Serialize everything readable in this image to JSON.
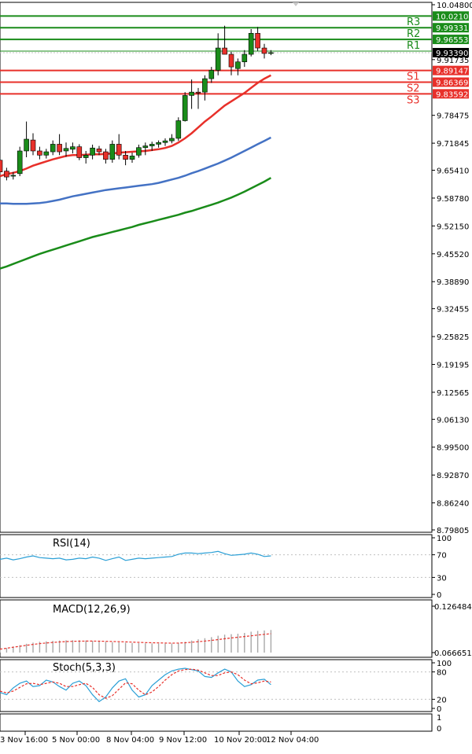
{
  "chart_data": [
    {
      "type": "candlestick",
      "title": "",
      "ylim": [
        8.79805,
        10.048
      ],
      "price_ticks": [
        "10.04800",
        "9.91735",
        "9.78475",
        "9.71845",
        "9.65410",
        "9.58780",
        "9.52150",
        "9.45520",
        "9.38890",
        "9.32455",
        "9.25825",
        "9.19195",
        "9.12565",
        "9.06130",
        "8.99500",
        "8.92870",
        "8.86240",
        "8.79805"
      ],
      "x_ticks": [
        "3 Nov 16:00",
        "5 Nov 00:00",
        "8 Nov 04:00",
        "9 Nov 12:00",
        "10 Nov 20:00",
        "12 Nov 04:00"
      ],
      "current_price": "9.93390",
      "levels": [
        {
          "label": "",
          "value": "10.02108",
          "kind": "resistance-top",
          "color": "#1a8c1a"
        },
        {
          "label": "R3",
          "value": "9.99331",
          "kind": "resistance",
          "color": "#1a8c1a"
        },
        {
          "label": "R2",
          "value": "9.96553",
          "kind": "resistance",
          "color": "#1a8c1a"
        },
        {
          "label": "R1",
          "value": "",
          "kind": "resistance",
          "color": "#1a8c1a"
        },
        {
          "label": "S1",
          "value": "9.89147",
          "kind": "support",
          "color": "#e8302a"
        },
        {
          "label": "S2",
          "value": "9.86369",
          "kind": "support",
          "color": "#e8302a"
        },
        {
          "label": "S3",
          "value": "9.83592",
          "kind": "support",
          "color": "#e8302a"
        }
      ],
      "candles": [
        [
          9.678,
          9.682,
          9.645,
          9.65
        ],
        [
          9.652,
          9.66,
          9.63,
          9.638
        ],
        [
          9.64,
          9.65,
          9.632,
          9.642
        ],
        [
          9.646,
          9.71,
          9.64,
          9.7
        ],
        [
          9.7,
          9.77,
          9.685,
          9.728
        ],
        [
          9.726,
          9.742,
          9.69,
          9.7
        ],
        [
          9.7,
          9.71,
          9.68,
          9.69
        ],
        [
          9.69,
          9.705,
          9.682,
          9.698
        ],
        [
          9.698,
          9.725,
          9.69,
          9.716
        ],
        [
          9.716,
          9.74,
          9.69,
          9.698
        ],
        [
          9.7,
          9.72,
          9.686,
          9.706
        ],
        [
          9.704,
          9.72,
          9.694,
          9.71
        ],
        [
          9.71,
          9.716,
          9.678,
          9.684
        ],
        [
          9.684,
          9.7,
          9.67,
          9.69
        ],
        [
          9.69,
          9.715,
          9.68,
          9.707
        ],
        [
          9.705,
          9.712,
          9.69,
          9.698
        ],
        [
          9.698,
          9.705,
          9.67,
          9.68
        ],
        [
          9.68,
          9.725,
          9.672,
          9.716
        ],
        [
          9.716,
          9.74,
          9.68,
          9.69
        ],
        [
          9.69,
          9.7,
          9.666,
          9.68
        ],
        [
          9.68,
          9.696,
          9.672,
          9.688
        ],
        [
          9.69,
          9.715,
          9.684,
          9.708
        ],
        [
          9.708,
          9.72,
          9.69,
          9.712
        ],
        [
          9.712,
          9.722,
          9.7,
          9.716
        ],
        [
          9.716,
          9.725,
          9.708,
          9.72
        ],
        [
          9.72,
          9.73,
          9.712,
          9.724
        ],
        [
          9.724,
          9.74,
          9.718,
          9.73
        ],
        [
          9.73,
          9.78,
          9.724,
          9.772
        ],
        [
          9.772,
          9.84,
          9.77,
          9.832
        ],
        [
          9.832,
          9.87,
          9.8,
          9.84
        ],
        [
          9.84,
          9.85,
          9.8,
          9.838
        ],
        [
          9.84,
          9.88,
          9.82,
          9.872
        ],
        [
          9.872,
          9.9,
          9.862,
          9.892
        ],
        [
          9.892,
          9.98,
          9.88,
          9.945
        ],
        [
          9.945,
          9.998,
          9.93,
          9.93
        ],
        [
          9.93,
          9.936,
          9.88,
          9.9
        ],
        [
          9.896,
          9.92,
          9.88,
          9.912
        ],
        [
          9.912,
          9.94,
          9.9,
          9.93
        ],
        [
          9.93,
          9.99,
          9.925,
          9.98
        ],
        [
          9.98,
          9.995,
          9.938,
          9.945
        ],
        [
          9.945,
          9.955,
          9.92,
          9.932
        ],
        [
          9.932,
          9.94,
          9.928,
          9.934
        ]
      ],
      "ma_red": [
        9.64,
        9.645,
        9.648,
        9.652,
        9.658,
        9.665,
        9.67,
        9.675,
        9.68,
        9.684,
        9.688,
        9.69,
        9.69,
        9.691,
        9.692,
        9.692,
        9.693,
        9.694,
        9.696,
        9.697,
        9.698,
        9.699,
        9.7,
        9.702,
        9.704,
        9.707,
        9.712,
        9.72,
        9.73,
        9.742,
        9.756,
        9.77,
        9.782,
        9.795,
        9.808,
        9.818,
        9.828,
        9.838,
        9.85,
        9.862,
        9.872,
        9.88
      ],
      "ma_blue": [
        9.575,
        9.575,
        9.574,
        9.574,
        9.574,
        9.575,
        9.576,
        9.578,
        9.581,
        9.584,
        9.588,
        9.592,
        9.595,
        9.598,
        9.601,
        9.604,
        9.607,
        9.609,
        9.611,
        9.613,
        9.615,
        9.617,
        9.619,
        9.621,
        9.624,
        9.628,
        9.632,
        9.636,
        9.641,
        9.647,
        9.652,
        9.658,
        9.664,
        9.67,
        9.677,
        9.684,
        9.692,
        9.7,
        9.708,
        9.716,
        9.724,
        9.732
      ],
      "ma_green": [
        9.42,
        9.425,
        9.431,
        9.437,
        9.443,
        9.449,
        9.455,
        9.46,
        9.465,
        9.47,
        9.475,
        9.48,
        9.485,
        9.49,
        9.495,
        9.499,
        9.503,
        9.507,
        9.511,
        9.515,
        9.519,
        9.524,
        9.528,
        9.532,
        9.536,
        9.54,
        9.544,
        9.548,
        9.553,
        9.557,
        9.562,
        9.567,
        9.572,
        9.577,
        9.583,
        9.589,
        9.596,
        9.603,
        9.611,
        9.619,
        9.627,
        9.636
      ]
    },
    {
      "type": "line",
      "title": "RSI(14)",
      "ylim": [
        0,
        100
      ],
      "y_ticks": [
        "100",
        "70",
        "30",
        "0"
      ],
      "levels": [
        70,
        30
      ],
      "series": [
        {
          "name": "",
          "color": "#2a9fd6",
          "values": [
            62,
            64,
            61,
            63,
            66,
            68,
            65,
            64,
            63,
            64,
            61,
            62,
            64,
            63,
            66,
            64,
            60,
            63,
            66,
            60,
            62,
            64,
            63,
            64,
            65,
            66,
            67,
            71,
            73,
            73,
            72,
            73,
            74,
            76,
            72,
            69,
            70,
            71,
            73,
            71,
            67,
            68
          ]
        }
      ]
    },
    {
      "type": "bar",
      "title": "MACD(12,26,9)",
      "ylim": [
        0.066651,
        0.126484
      ],
      "y_ticks": [
        "0.126484",
        "0.066651"
      ],
      "series": [
        {
          "name": "",
          "color": "#a8a8a8",
          "values": [
            0.0705,
            0.0725,
            0.0745,
            0.0762,
            0.078,
            0.0795,
            0.0806,
            0.0812,
            0.0818,
            0.0822,
            0.0825,
            0.0826,
            0.0825,
            0.0822,
            0.0818,
            0.0812,
            0.0805,
            0.08,
            0.0798,
            0.0794,
            0.079,
            0.0788,
            0.0786,
            0.0784,
            0.0782,
            0.0781,
            0.0783,
            0.0791,
            0.0805,
            0.0822,
            0.0838,
            0.0852,
            0.0866,
            0.0884,
            0.0898,
            0.0904,
            0.091,
            0.092,
            0.0936,
            0.0946,
            0.0952,
            0.0958
          ]
        },
        {
          "name": "",
          "color": "#e8302a",
          "values": [
            0.071,
            0.0722,
            0.0735,
            0.0748,
            0.076,
            0.0772,
            0.0782,
            0.079,
            0.0797,
            0.0803,
            0.0808,
            0.0812,
            0.0814,
            0.0815,
            0.0815,
            0.0814,
            0.0812,
            0.081,
            0.0807,
            0.0804,
            0.0801,
            0.0798,
            0.0795,
            0.0793,
            0.0791,
            0.0789,
            0.0788,
            0.0789,
            0.0793,
            0.0799,
            0.0807,
            0.0815,
            0.0824,
            0.0834,
            0.0845,
            0.0855,
            0.0864,
            0.0873,
            0.0883,
            0.0893,
            0.0902,
            0.091
          ]
        }
      ]
    },
    {
      "type": "line",
      "title": "Stoch(5,3,3)",
      "ylim": [
        0,
        100
      ],
      "y_ticks": [
        "100",
        "80",
        "20",
        "0"
      ],
      "levels": [
        80,
        20
      ],
      "series": [
        {
          "name": "",
          "color": "#2a9fd6",
          "values": [
            35,
            30,
            45,
            55,
            60,
            48,
            50,
            62,
            58,
            48,
            40,
            55,
            60,
            50,
            30,
            15,
            25,
            45,
            60,
            65,
            40,
            25,
            30,
            50,
            62,
            74,
            82,
            86,
            88,
            85,
            82,
            70,
            68,
            78,
            86,
            80,
            60,
            48,
            52,
            62,
            64,
            52
          ]
        },
        {
          "name": "",
          "color": "#e8302a",
          "values": [
            38,
            34,
            38,
            46,
            54,
            55,
            52,
            55,
            58,
            55,
            48,
            48,
            52,
            55,
            46,
            30,
            22,
            28,
            42,
            56,
            54,
            40,
            30,
            36,
            48,
            62,
            74,
            82,
            85,
            86,
            84,
            78,
            72,
            72,
            78,
            80,
            74,
            62,
            54,
            56,
            60,
            58
          ]
        }
      ]
    },
    {
      "type": "line",
      "title": "",
      "ylim": [
        0,
        1
      ],
      "y_ticks": [
        "1",
        "0"
      ],
      "series": []
    }
  ]
}
